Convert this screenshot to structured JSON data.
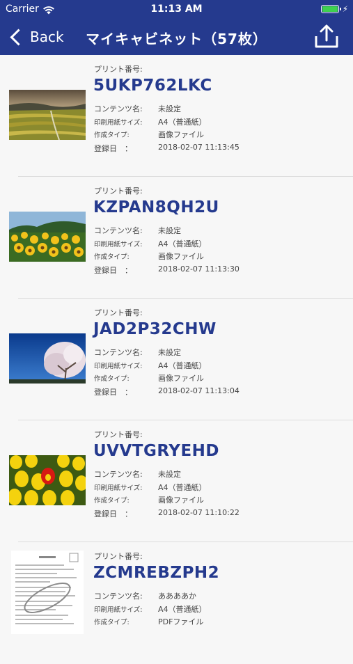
{
  "status_bar": {
    "carrier": "Carrier",
    "time": "11:13 AM"
  },
  "nav": {
    "back_label": "Back",
    "title": "マイキャビネット（57枚）"
  },
  "labels": {
    "print_no": "プリント番号:",
    "content_name": "コンテンツ名:",
    "paper_size": "印刷用紙サイズ:",
    "create_type": "作成タイプ:",
    "registered": "登録日　："
  },
  "items": [
    {
      "code": "5UKP762LKC",
      "content": "未設定",
      "paper": "A4（普通紙）",
      "type": "画像ファイル",
      "date": "2018-02-07 11:13:45",
      "thumb": "rice-terraces"
    },
    {
      "code": "KZPAN8QH2U",
      "content": "未設定",
      "paper": "A4（普通紙）",
      "type": "画像ファイル",
      "date": "2018-02-07 11:13:30",
      "thumb": "sunflowers"
    },
    {
      "code": "JAD2P32CHW",
      "content": "未設定",
      "paper": "A4（普通紙）",
      "type": "画像ファイル",
      "date": "2018-02-07 11:13:04",
      "thumb": "cherry-blossom"
    },
    {
      "code": "UVVTGRYEHD",
      "content": "未設定",
      "paper": "A4（普通紙）",
      "type": "画像ファイル",
      "date": "2018-02-07 11:10:22",
      "thumb": "tulips"
    },
    {
      "code": "ZCMREBZPH2",
      "content": "ああああか",
      "paper": "A4（普通紙）",
      "type": "PDFファイル",
      "thumb": "document"
    }
  ]
}
